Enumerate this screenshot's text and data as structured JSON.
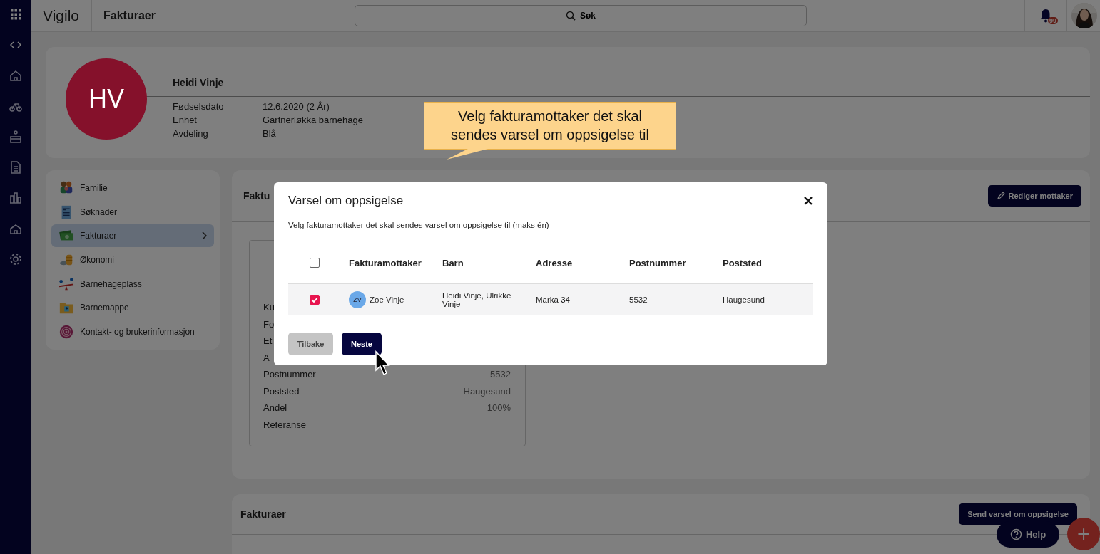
{
  "topbar": {
    "brand": "Vigilo",
    "title": "Fakturaer",
    "search": {
      "label": "Søk"
    },
    "notification_badge": "99"
  },
  "profile": {
    "initials": "HV",
    "name": "Heidi Vinje",
    "fields": [
      {
        "label": "Fødselsdato",
        "value": "12.6.2020 (2 År)"
      },
      {
        "label": "Enhet",
        "value": "Gartnerløkka barnehage"
      },
      {
        "label": "Avdeling",
        "value": "Blå"
      }
    ]
  },
  "menu": {
    "items": [
      {
        "label": "Familie",
        "kind": "family",
        "selected": false
      },
      {
        "label": "Søknader",
        "kind": "form",
        "selected": false
      },
      {
        "label": "Fakturaer",
        "kind": "money",
        "selected": true
      },
      {
        "label": "Økonomi",
        "kind": "coins",
        "selected": false
      },
      {
        "label": "Barnehageplass",
        "kind": "seesaw",
        "selected": false
      },
      {
        "label": "Barnemappe",
        "kind": "folder",
        "selected": false
      },
      {
        "label": "Kontakt- og brukerinformasjon",
        "kind": "fingerprint",
        "selected": false
      }
    ]
  },
  "recipient_panel": {
    "title": "Faktu",
    "edit_button": "Rediger mottaker",
    "rows": [
      {
        "label": "Ku"
      },
      {
        "label": "Fo"
      },
      {
        "label": "Et"
      },
      {
        "label": "A"
      },
      {
        "label": "Postnummer",
        "value": "5532"
      },
      {
        "label": "Poststed",
        "value": "Haugesund"
      },
      {
        "label": "Andel",
        "value": "100%"
      },
      {
        "label": "Referanse"
      }
    ]
  },
  "invoices_panel": {
    "title": "Fakturaer",
    "button": "Send varsel om oppsigelse"
  },
  "help_button": "Help",
  "add_button": "+",
  "callout": "Velg fakturamottaker det skal sendes varsel om oppsigelse til",
  "dialog": {
    "title": "Varsel om oppsigelse",
    "instruction": "Velg fakturamottaker det skal sendes varsel om oppsigelse til (maks én)",
    "select_all": {
      "checked": false
    },
    "columns": [
      "Fakturamottaker",
      "Barn",
      "Adresse",
      "Postnummer",
      "Poststed"
    ],
    "rows": [
      {
        "selected": true,
        "initials": "ZV",
        "name": "Zoe Vinje",
        "children": "Heidi Vinje, Ulrikke Vinje",
        "address": "Marka 34",
        "postal_code": "5532",
        "city": "Haugesund"
      }
    ],
    "buttons": [
      {
        "label": "Tilbake",
        "kind": "secondary"
      },
      {
        "label": "Neste",
        "kind": "primary"
      }
    ]
  }
}
